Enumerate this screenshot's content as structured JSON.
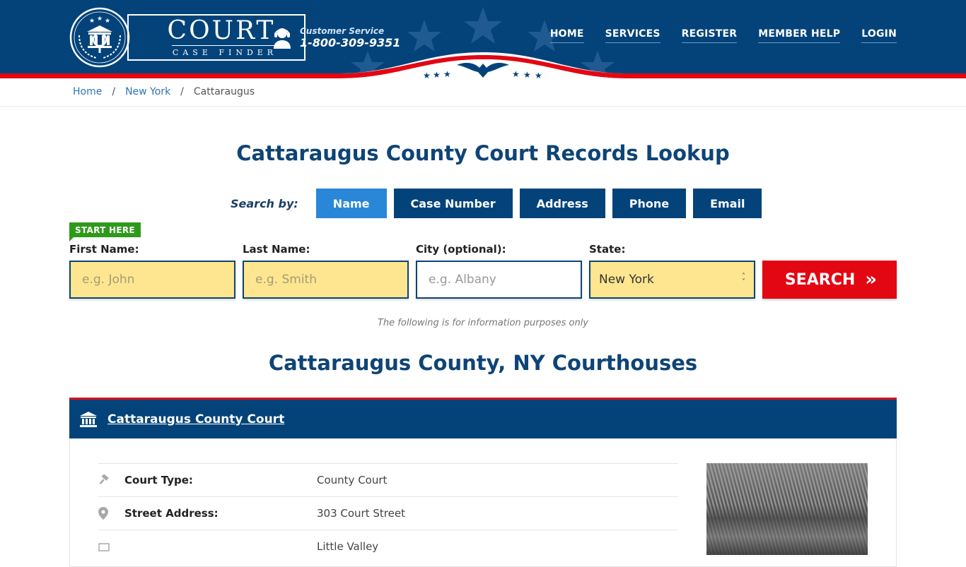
{
  "header": {
    "logo": {
      "title": "COURT",
      "subtitle": "CASE FINDER"
    },
    "customer_service": {
      "label": "Customer Service",
      "phone": "1-800-309-9351"
    },
    "nav": [
      {
        "label": "HOME"
      },
      {
        "label": "SERVICES"
      },
      {
        "label": "REGISTER"
      },
      {
        "label": "MEMBER HELP"
      },
      {
        "label": "LOGIN"
      }
    ]
  },
  "breadcrumb": {
    "items": [
      {
        "label": "Home"
      },
      {
        "label": "New York"
      },
      {
        "label": "Cattaraugus"
      }
    ],
    "separator": "/"
  },
  "page_title": "Cattaraugus County Court Records Lookup",
  "search": {
    "search_by_label": "Search by:",
    "tabs": [
      {
        "label": "Name",
        "active": true
      },
      {
        "label": "Case Number",
        "active": false
      },
      {
        "label": "Address",
        "active": false
      },
      {
        "label": "Phone",
        "active": false
      },
      {
        "label": "Email",
        "active": false
      }
    ],
    "start_here": "START HERE",
    "fields": {
      "first_name": {
        "label": "First Name:",
        "placeholder": "e.g. John",
        "value": ""
      },
      "last_name": {
        "label": "Last Name:",
        "placeholder": "e.g. Smith",
        "value": ""
      },
      "city": {
        "label": "City (optional):",
        "placeholder": "e.g.  Albany",
        "value": ""
      },
      "state": {
        "label": "State:",
        "value": "New York"
      }
    },
    "button_label": "SEARCH",
    "button_arrow": "»"
  },
  "info_note": "The following is for information purposes only",
  "courthouses_title": "Cattaraugus County, NY Courthouses",
  "court": {
    "name": "Cattaraugus County Court",
    "details": [
      {
        "icon": "gavel-icon",
        "glyph": "✎",
        "label": "Court Type:",
        "value": "County Court"
      },
      {
        "icon": "map-pin-icon",
        "glyph": "⬤",
        "label": "Street Address:",
        "value": "303 Court Street"
      },
      {
        "icon": "city-icon",
        "glyph": "▭",
        "label": "",
        "value": "Little Valley"
      }
    ]
  },
  "colors": {
    "brand_navy": "#03437a",
    "accent_blue": "#2a87d8",
    "search_red": "#e30613",
    "start_green": "#2e9a1a",
    "input_yellow": "#fde68f"
  }
}
